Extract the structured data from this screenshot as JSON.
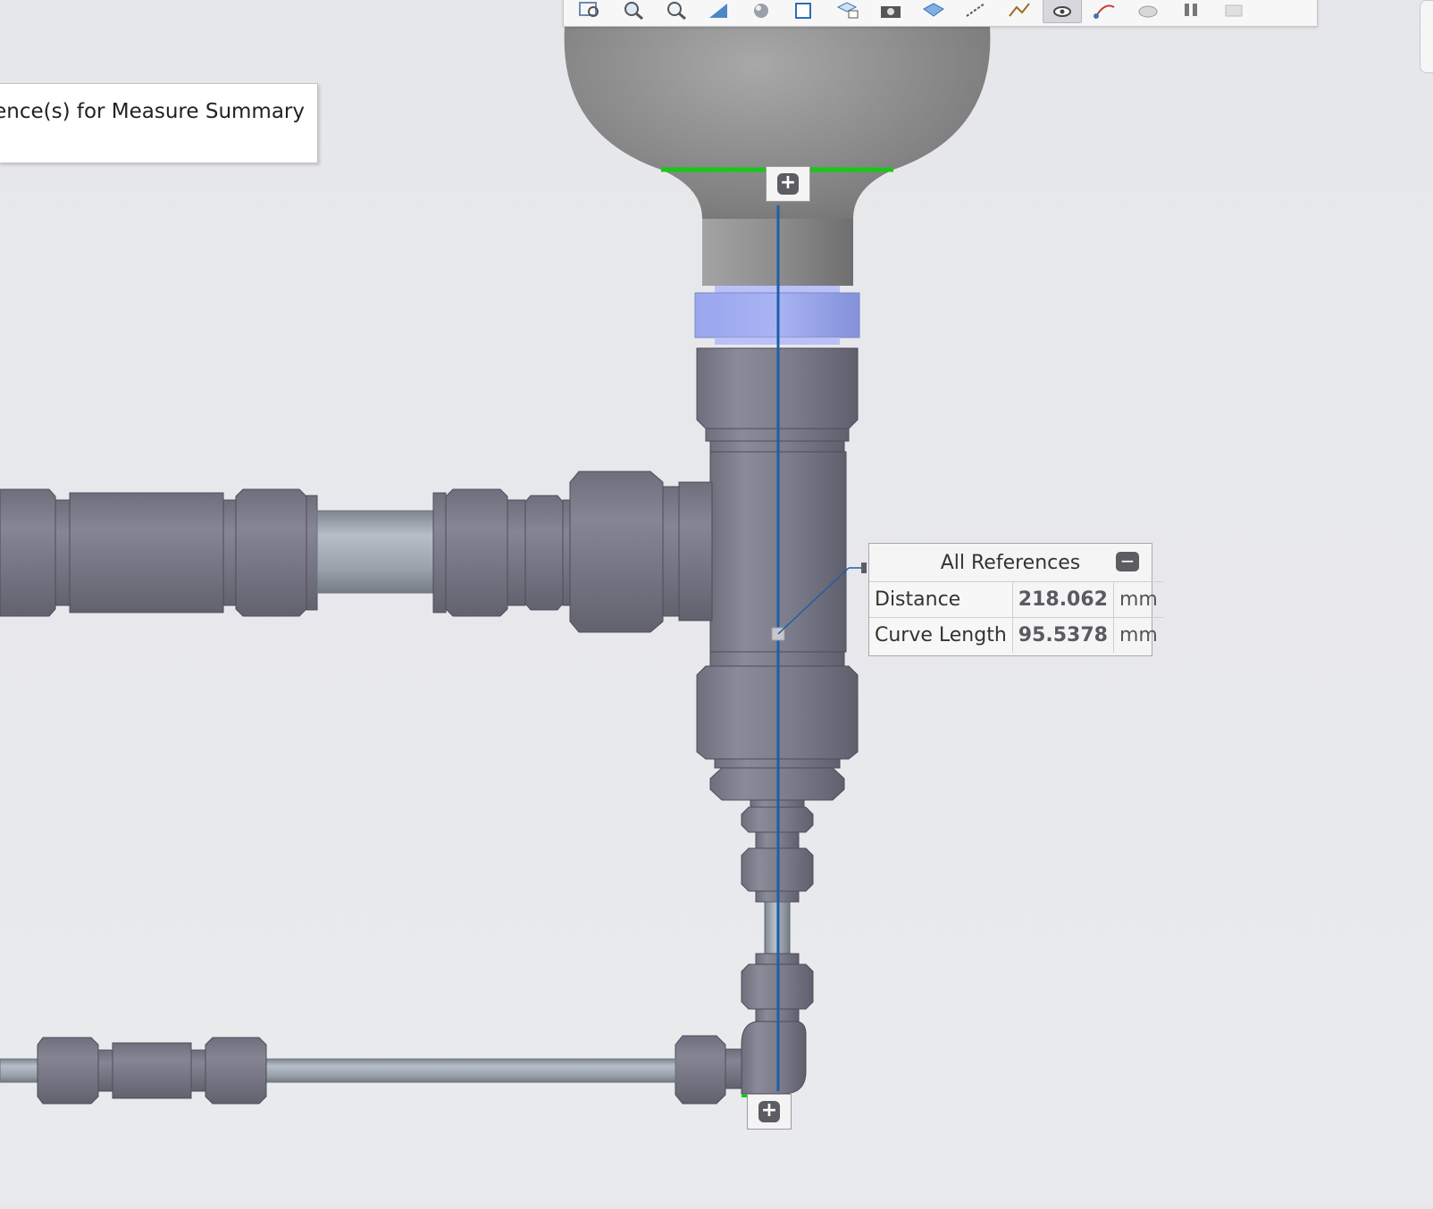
{
  "message": {
    "text": "erence(s) for Measure Summary"
  },
  "references_panel": {
    "title": "All References",
    "rows": [
      {
        "label": "Distance",
        "value": "218.062",
        "unit": "mm"
      },
      {
        "label": "Curve Length",
        "value": "95.5378",
        "unit": "mm"
      }
    ]
  },
  "toolbar_icons": [
    "zoom-to-fit-icon",
    "zoom-area-icon",
    "zoom-out-icon",
    "section-view-icon",
    "appearance-icon",
    "display-style-icon",
    "view-orientation-icon",
    "camera-icon",
    "scene-icon",
    "hide-show-icon",
    "sketch-icon",
    "view-settings-icon",
    "route-icon",
    "cloud-icon",
    "pause-icon",
    "more-icon"
  ],
  "colors": {
    "background": "#e8e9ec",
    "measure_line": "#1b5fa8",
    "edge_highlight": "#19c61a",
    "part_gray": "#7b7b8a",
    "bulb_gray": "#8d8d8d",
    "ring_blue": "#a4b0f2"
  }
}
